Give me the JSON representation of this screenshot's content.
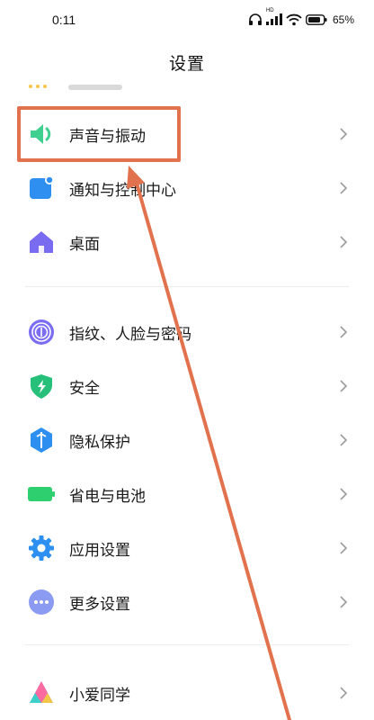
{
  "status_bar": {
    "time": "0:11",
    "battery": "65%",
    "network_badge": "HD"
  },
  "header": {
    "title": "设置"
  },
  "settings_groups": [
    {
      "items": [
        {
          "label": "声音与振动",
          "icon": "speaker-icon",
          "color": "#3fcf8e"
        },
        {
          "label": "通知与控制中心",
          "icon": "notification-icon",
          "color": "#2f8ff0"
        },
        {
          "label": "桌面",
          "icon": "home-icon",
          "color": "#7a6cf0"
        }
      ]
    },
    {
      "items": [
        {
          "label": "指纹、人脸与密码",
          "icon": "fingerprint-icon",
          "color": "#7b6df2"
        },
        {
          "label": "安全",
          "icon": "shield-icon",
          "color": "#27c07a"
        },
        {
          "label": "隐私保护",
          "icon": "privacy-icon",
          "color": "#2d8ff0"
        },
        {
          "label": "省电与电池",
          "icon": "battery-icon",
          "color": "#2ecf6e"
        },
        {
          "label": "应用设置",
          "icon": "gear-icon",
          "color": "#2d8ff0"
        },
        {
          "label": "更多设置",
          "icon": "more-icon",
          "color": "#8c9bf2"
        }
      ]
    },
    {
      "items": [
        {
          "label": "小爱同学",
          "icon": "xiaoai-icon",
          "color": "#5a6df2"
        }
      ]
    }
  ],
  "annotation": {
    "highlight_color": "#e2714d"
  }
}
